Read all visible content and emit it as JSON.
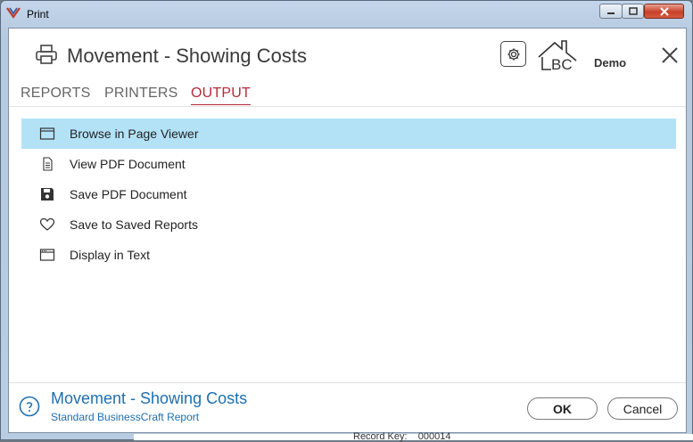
{
  "window": {
    "title": "Print"
  },
  "header": {
    "title": "Movement - Showing Costs",
    "logo_text": "BC",
    "logo_badge": "Demo"
  },
  "tabs": [
    {
      "label": "REPORTS",
      "active": false
    },
    {
      "label": "PRINTERS",
      "active": false
    },
    {
      "label": "OUTPUT",
      "active": true
    }
  ],
  "output_options": [
    {
      "label": "Browse in Page Viewer",
      "icon": "page-viewer-icon",
      "selected": true
    },
    {
      "label": "View PDF Document",
      "icon": "document-icon",
      "selected": false
    },
    {
      "label": "Save PDF Document",
      "icon": "floppy-disk-icon",
      "selected": false
    },
    {
      "label": "Save to Saved Reports",
      "icon": "heart-icon",
      "selected": false
    },
    {
      "label": "Display in Text",
      "icon": "text-window-icon",
      "selected": false
    }
  ],
  "footer": {
    "report_title": "Movement - Showing Costs",
    "report_subtitle": "Standard BusinessCraft Report",
    "ok_label": "OK",
    "cancel_label": "Cancel"
  },
  "background": {
    "text": "Record Key:    000014"
  },
  "colors": {
    "accent": "#b32b3a",
    "selection": "#b3e2f7",
    "link_blue": "#1e6fb0"
  }
}
